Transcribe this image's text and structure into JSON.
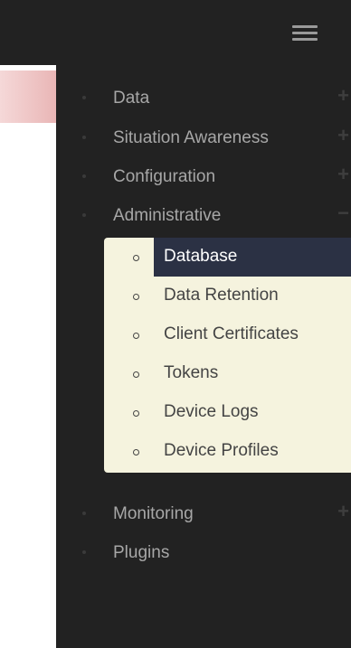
{
  "header": {
    "menu_icon": "hamburger-icon"
  },
  "nav": {
    "items": [
      {
        "label": "Data",
        "toggle": "+"
      },
      {
        "label": "Situation Awareness",
        "toggle": "+"
      },
      {
        "label": "Configuration",
        "toggle": "+"
      },
      {
        "label": "Administrative",
        "toggle": "−"
      },
      {
        "label": "Monitoring",
        "toggle": "+"
      },
      {
        "label": "Plugins",
        "toggle": ""
      }
    ],
    "administrative_sub": [
      {
        "label": "Database",
        "active": true
      },
      {
        "label": "Data Retention"
      },
      {
        "label": "Client Certificates"
      },
      {
        "label": "Tokens"
      },
      {
        "label": "Device Logs"
      },
      {
        "label": "Device Profiles"
      }
    ]
  },
  "colors": {
    "sidebar_bg": "#222222",
    "submenu_bg": "#f5f3de",
    "active_bg": "#2b3144"
  }
}
